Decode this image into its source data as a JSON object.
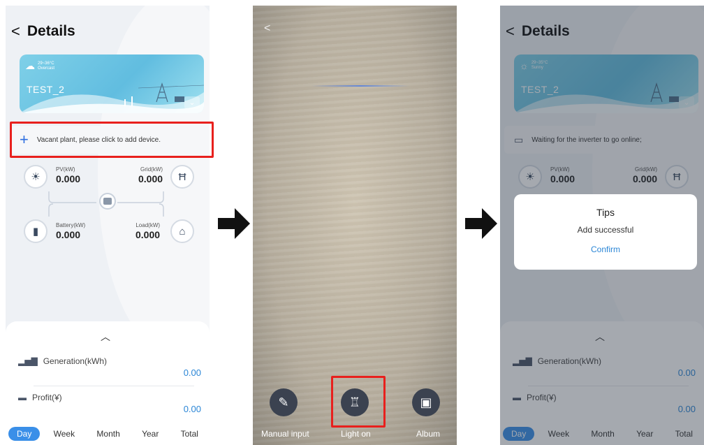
{
  "screens": {
    "details_before": {
      "header": {
        "back": "<",
        "title": "Details"
      },
      "weather": {
        "temp": "29~36°C",
        "condition": "Overcast",
        "icon": "cloud-icon"
      },
      "plant_name": "TEST_2",
      "notice": {
        "text": "Vacant plant, please click to add device.",
        "icon": "plus-icon"
      },
      "flow": {
        "pv": {
          "label": "PV(kW)",
          "value": "0.000"
        },
        "grid": {
          "label": "Grid(kW)",
          "value": "0.000"
        },
        "battery": {
          "label": "Battery(kW)",
          "value": "0.000"
        },
        "load": {
          "label": "Load(kW)",
          "value": "0.000"
        }
      },
      "stats": {
        "generation": {
          "label": "Generation(kWh)",
          "value": "0.00"
        },
        "profit": {
          "label": "Profit(¥)",
          "value": "0.00"
        }
      },
      "tabs": [
        "Day",
        "Week",
        "Month",
        "Year",
        "Total"
      ],
      "active_tab": "Day"
    },
    "scanner": {
      "back": "<",
      "buttons": {
        "manual": "Manual input",
        "light": "Light on",
        "album": "Album"
      }
    },
    "details_after": {
      "header": {
        "back": "<",
        "title": "Details"
      },
      "weather": {
        "temp": "29~35°C",
        "condition": "Sunny",
        "icon": "sun-icon"
      },
      "plant_name": "TEST_2",
      "notice": {
        "text": "Waiting for the inverter to go online;",
        "icon": "inverter-icon"
      },
      "flow": {
        "pv": {
          "label": "PV(kW)",
          "value": "0.000"
        },
        "grid": {
          "label": "Grid(kW)",
          "value": "0.000"
        }
      },
      "dialog": {
        "title": "Tips",
        "message": "Add successful",
        "confirm": "Confirm"
      },
      "stats": {
        "generation": {
          "label": "Generation(kWh)",
          "value": "0.00"
        },
        "profit": {
          "label": "Profit(¥)",
          "value": "0.00"
        }
      },
      "tabs": [
        "Day",
        "Week",
        "Month",
        "Year",
        "Total"
      ],
      "active_tab": "Day"
    }
  },
  "colors": {
    "accent": "#3a8fe8",
    "value_blue": "#2b86d6",
    "highlight_red": "#e8201d"
  }
}
